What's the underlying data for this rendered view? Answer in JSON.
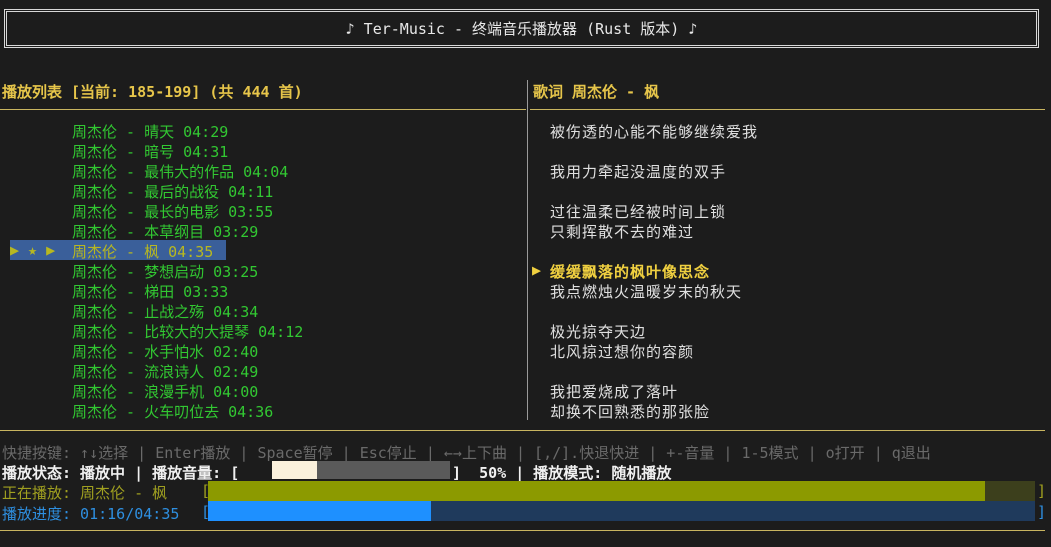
{
  "header": {
    "title": "♪ Ter-Music - 终端音乐播放器 (Rust 版本) ♪"
  },
  "playlist": {
    "title": "播放列表 [当前: 185-199] (共 444 首)",
    "selected_prefix": "▶ ★ ▶",
    "items": [
      "周杰伦 - 晴天 04:29",
      "周杰伦 - 暗号 04:31",
      "周杰伦 - 最伟大的作品 04:04",
      "周杰伦 - 最后的战役 04:11",
      "周杰伦 - 最长的电影 03:55",
      "周杰伦 - 本草纲目 03:29",
      "周杰伦 - 枫 04:35",
      "周杰伦 - 梦想启动 03:25",
      "周杰伦 - 梯田 03:33",
      "周杰伦 - 止战之殇 04:34",
      "周杰伦 - 比较大的大提琴 04:12",
      "周杰伦 - 水手怕水 02:40",
      "周杰伦 - 流浪诗人 02:49",
      "周杰伦 - 浪漫手机 04:00",
      "周杰伦 - 火车叨位去 04:36"
    ],
    "selected_index": 6
  },
  "lyrics": {
    "title": "歌词 周杰伦 - 枫",
    "active_marker": "▶",
    "lines": [
      "被伤透的心能不能够继续爱我",
      "",
      "我用力牵起没温度的双手",
      "",
      "过往温柔已经被时间上锁",
      "只剩挥散不去的难过",
      "",
      "缓缓飘落的枫叶像思念",
      "我点燃烛火温暖岁末的秋天",
      "",
      "极光掠夺天边",
      "北风掠过想你的容颜",
      "",
      "我把爱烧成了落叶",
      "却换不回熟悉的那张脸"
    ],
    "active_index": 7
  },
  "footer": {
    "help": "快捷按键: ↑↓选择 | Enter播放 | Space暂停 | Esc停止 | ←→上下曲 | [,/].快退快进 | +-音量 | 1-5模式 | o打开 | q退出",
    "status_label": "播放状态: 播放中 | 播放音量: [",
    "volume_close": "]  50% | 播放模式: 随机播放",
    "volume_percent": 50,
    "now_playing_label": "正在播放: 周杰伦 - 枫",
    "now_playing_fill": 0.94,
    "progress_label": "播放进度: 01:16/04:35",
    "progress_fill": 0.27,
    "bracket_open": "[",
    "bracket_close": "]"
  },
  "colors": {
    "accent_yellow": "#e6c54a",
    "song_green": "#32c832",
    "selection_blue": "#3a5f9a",
    "now_playing_olive": "#8c9a00",
    "progress_blue": "#1e90ff"
  }
}
